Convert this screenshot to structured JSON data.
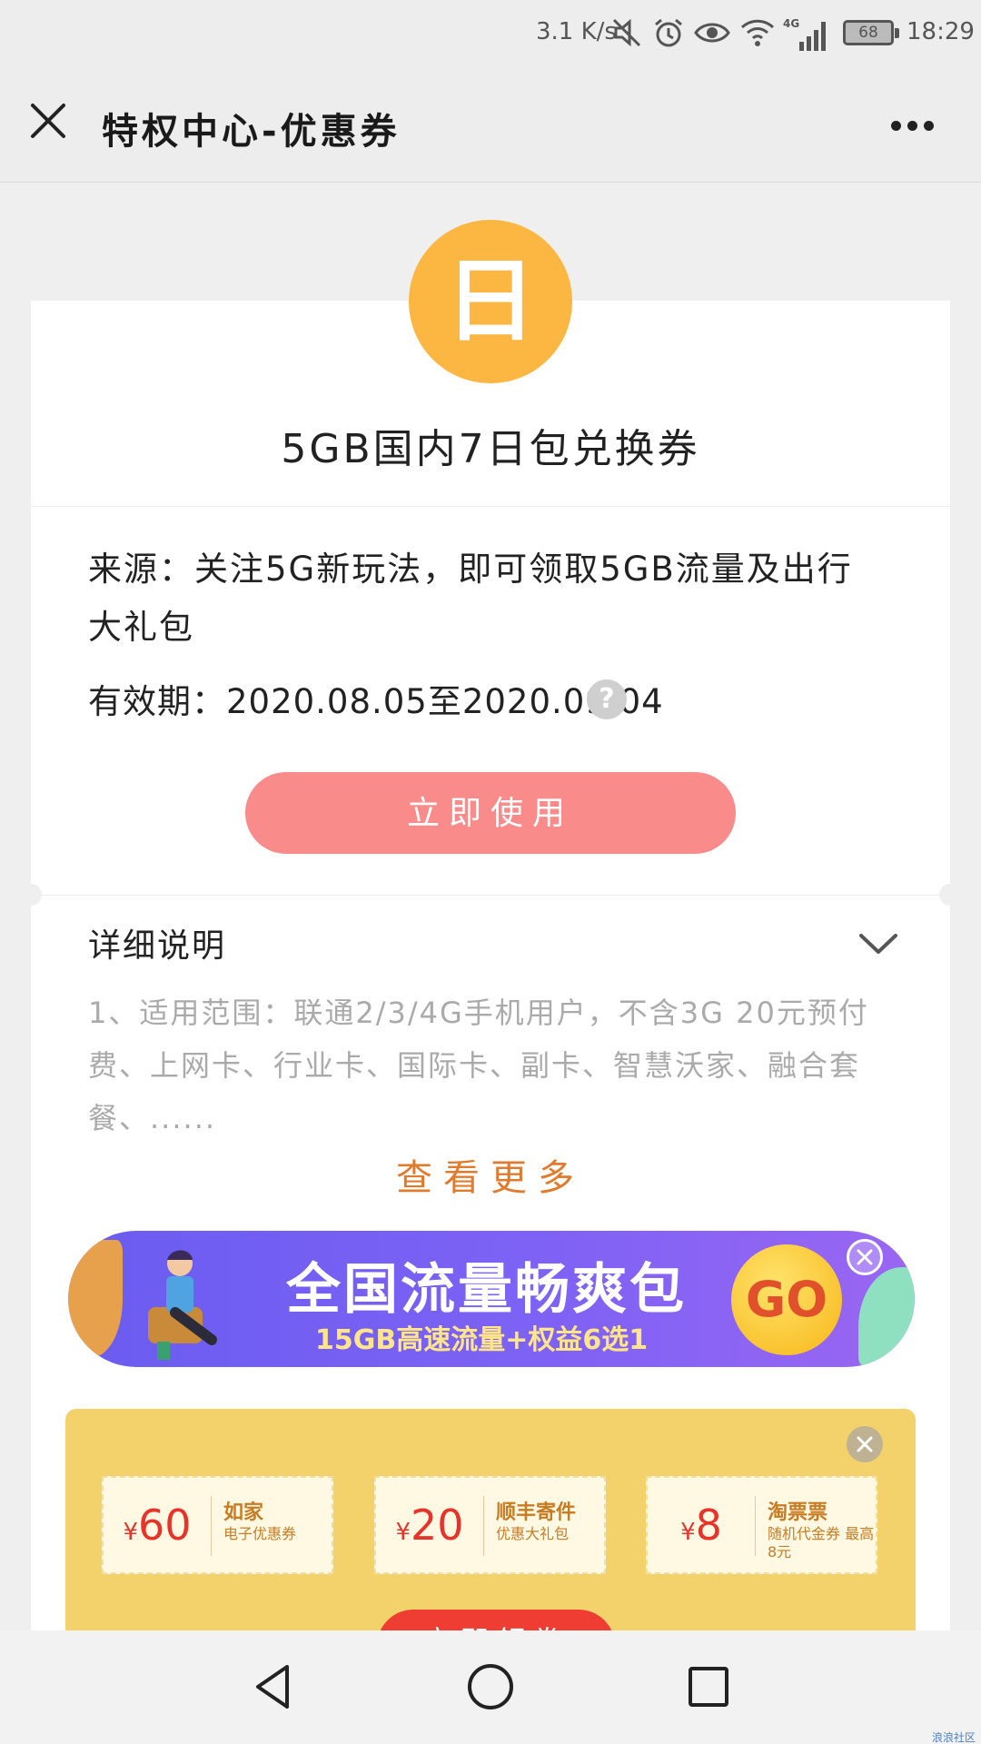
{
  "status_bar": {
    "net_speed": "3.1 K/s",
    "network": "4G",
    "battery": "68",
    "time": "18:29"
  },
  "header": {
    "title": "特权中心-优惠券"
  },
  "coupon": {
    "badge_char": "日",
    "title": "5GB国内7日包兑换券",
    "source": "来源：关注5G新玩法，即可领取5GB流量及出行大礼包",
    "validity": "有效期：2020.08.05至2020.09.04",
    "use_button": "立即使用",
    "detail_heading": "详细说明",
    "detail_text": "1、适用范围：联通2/3/4G手机用户，不含3G 20元预付费、上网卡、行业卡、国际卡、副卡、智慧沃家、融合套餐、......",
    "see_more": "查看更多"
  },
  "promo_banner": {
    "title": "全国流量畅爽包",
    "subtitle": "15GB高速流量+权益6选1",
    "go": "GO"
  },
  "coupon_panel": {
    "items": [
      {
        "currency": "¥",
        "amount": "60",
        "name": "如家",
        "desc": "电子优惠券"
      },
      {
        "currency": "¥",
        "amount": "20",
        "name": "顺丰寄件",
        "desc": "优惠大礼包"
      },
      {
        "currency": "¥",
        "amount": "8",
        "name": "淘票票",
        "desc": "随机代金券 最高8元"
      }
    ],
    "claim_button": "立即领券"
  },
  "icons": [
    "mute-icon",
    "alarm-icon",
    "eye-icon",
    "wifi-icon",
    "signal-icon",
    "close-icon",
    "more-icon",
    "help-icon",
    "chevron-down-icon",
    "back-icon",
    "home-icon",
    "recents-icon"
  ],
  "watermark": "浪浪社区"
}
